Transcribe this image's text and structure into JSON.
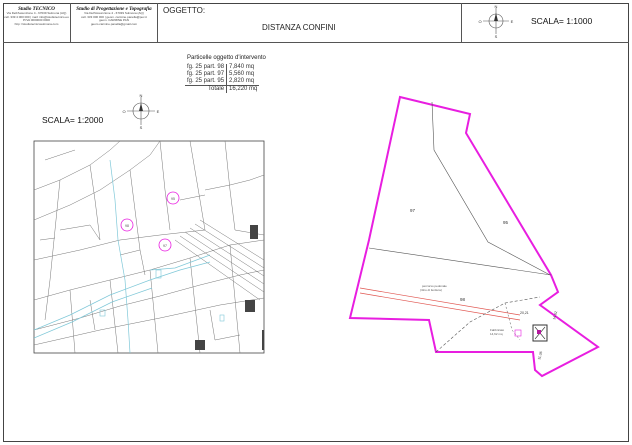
{
  "studio_left": {
    "name": "Studio TECNICO",
    "lines": [
      "Via Dell'Assunzione 4 - 67039 Sulmona (AQ)",
      "cell. 339 4 000 000 | mail: info@studiotecnico.eu",
      "P.IVA 0000000 0000",
      "http: //studiotecnicosulmona.com"
    ]
  },
  "studio_right": {
    "name": "Studio di Progettazione e Topografia",
    "lines": [
      "Via Dell'Assunzione 4 - 67039 Sulmona (AQ)",
      "cell. 333 000 000 | geom. carmine.panella@pec.it",
      "geom. CARMINE PAN",
      "geom.carmine.panella@gmail.com"
    ]
  },
  "header": {
    "oggetto_label": "OGGETTO:",
    "title": "DISTANZA CONFINI",
    "scale_right": "SCALA= 1:1000"
  },
  "compass_labels": {
    "n": "N",
    "s": "S",
    "e": "E",
    "o": "O"
  },
  "particelle": {
    "title": "Particelle oggetto d'intervento",
    "rows": [
      {
        "ref": "fg. 25 part. 98",
        "area": "7,840 mq"
      },
      {
        "ref": "fg. 25 part. 97",
        "area": "5,560 mq"
      },
      {
        "ref": "fg. 25 part. 95",
        "area": "2,820 mq"
      }
    ],
    "total_label": "Totale",
    "total_value": "16,220 mq"
  },
  "scale_left": "SCALA= 1:2000",
  "map_labels": {
    "p97": "97",
    "p95": "95",
    "p98": "98",
    "road_note_1": "percorso pedonale",
    "road_note_2": "(ritiro di fenitura)",
    "dim_a": "20,21",
    "dim_b": "14,62",
    "dim_c": "11,36",
    "building_note_1": "Fabbricato",
    "building_note_2": "14,62 mq",
    "cad_a": "98",
    "cad_b": "95",
    "cad_c": "97"
  },
  "colors": {
    "boundary": "#e81ee0",
    "road": "#e0554f",
    "cadastral_line": "#7a7a7a",
    "water_line": "#7fc8d8"
  }
}
